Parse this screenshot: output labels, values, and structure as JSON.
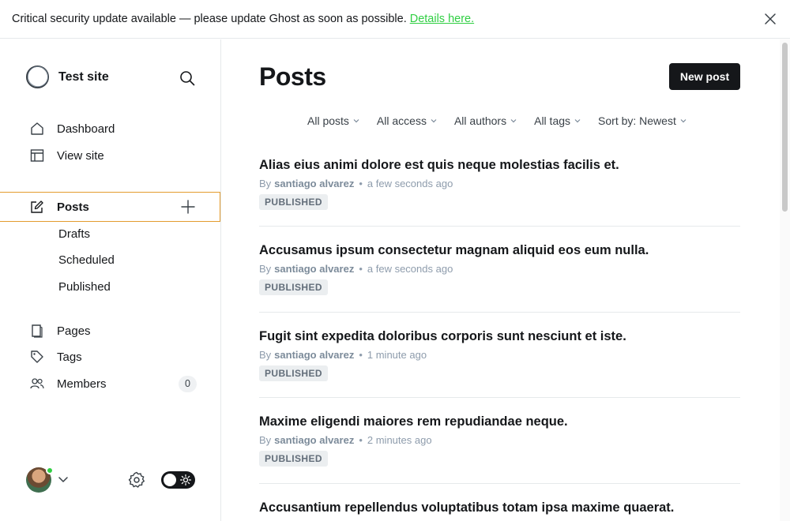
{
  "banner": {
    "text": "Critical security update available — please update Ghost as soon as possible.",
    "link": "Details here."
  },
  "sidebar": {
    "site_title": "Test site",
    "nav": [
      {
        "label": "Dashboard",
        "icon": "home-icon"
      },
      {
        "label": "View site",
        "icon": "layout-icon"
      }
    ],
    "posts": {
      "label": "Posts",
      "icon": "edit-icon"
    },
    "post_sub": [
      "Drafts",
      "Scheduled",
      "Published"
    ],
    "content_nav": [
      {
        "label": "Pages",
        "icon": "page-icon"
      },
      {
        "label": "Tags",
        "icon": "tag-icon"
      },
      {
        "label": "Members",
        "icon": "members-icon",
        "count": "0"
      }
    ]
  },
  "main": {
    "title": "Posts",
    "new_post": "New post",
    "filters": [
      "All posts",
      "All access",
      "All authors",
      "All tags",
      "Sort by: Newest"
    ],
    "posts": [
      {
        "title": "Alias eius animi dolore est quis neque molestias facilis et.",
        "by": "By",
        "author": "santiago alvarez",
        "time": "a few seconds ago",
        "status": "PUBLISHED"
      },
      {
        "title": "Accusamus ipsum consectetur magnam aliquid eos eum nulla.",
        "by": "By",
        "author": "santiago alvarez",
        "time": "a few seconds ago",
        "status": "PUBLISHED"
      },
      {
        "title": "Fugit sint expedita doloribus corporis sunt nesciunt et iste.",
        "by": "By",
        "author": "santiago alvarez",
        "time": "1 minute ago",
        "status": "PUBLISHED"
      },
      {
        "title": "Maxime eligendi maiores rem repudiandae neque.",
        "by": "By",
        "author": "santiago alvarez",
        "time": "2 minutes ago",
        "status": "PUBLISHED"
      },
      {
        "title": "Accusantium repellendus voluptatibus totam ipsa maxime quaerat."
      }
    ]
  },
  "colors": {
    "accent_link": "#30cf43",
    "active_outline": "#e39b2e",
    "button_dark": "#15171a"
  }
}
